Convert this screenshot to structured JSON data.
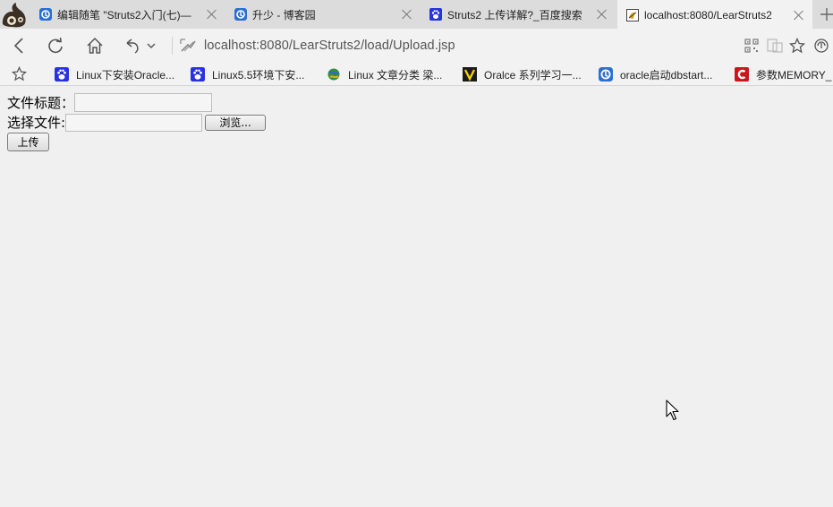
{
  "browser": {
    "tabs": [
      {
        "label": "编辑随笔 \"Struts2入门(七)—",
        "icon": "cnblogs-icon",
        "active": false
      },
      {
        "label": "升少 - 博客园",
        "icon": "cnblogs-icon",
        "active": false
      },
      {
        "label": "Struts2 上传详解?_百度搜索",
        "icon": "baidu-paw-icon",
        "active": false
      },
      {
        "label": "localhost:8080/LearStruts2",
        "icon": "tomcat-icon",
        "active": true
      }
    ],
    "address": "localhost:8080/LearStruts2/load/Upload.jsp",
    "bookmarks": [
      {
        "label": "Linux下安装Oracle...",
        "icon": "baidu-paw-icon"
      },
      {
        "label": "Linux5.5环境下安...",
        "icon": "baidu-paw-icon"
      },
      {
        "label": "Linux 文章分类 梁...",
        "icon": "globe-icon"
      },
      {
        "label": "Oralce 系列学习一...",
        "icon": "v-icon"
      },
      {
        "label": "oracle启动dbstart...",
        "icon": "cnblogs-icon"
      },
      {
        "label": "参数MEMORY_",
        "icon": "csdn-icon"
      }
    ],
    "colors": {
      "tabbar": "#dcdcdc",
      "toolbar": "#f2f2f2",
      "page_bg": "#f0f0f0"
    }
  },
  "form": {
    "title_label": "文件标题：",
    "title_value": "",
    "file_label": "选择文件:",
    "file_value": "",
    "browse_label": "浏览...",
    "submit_label": "上传"
  }
}
